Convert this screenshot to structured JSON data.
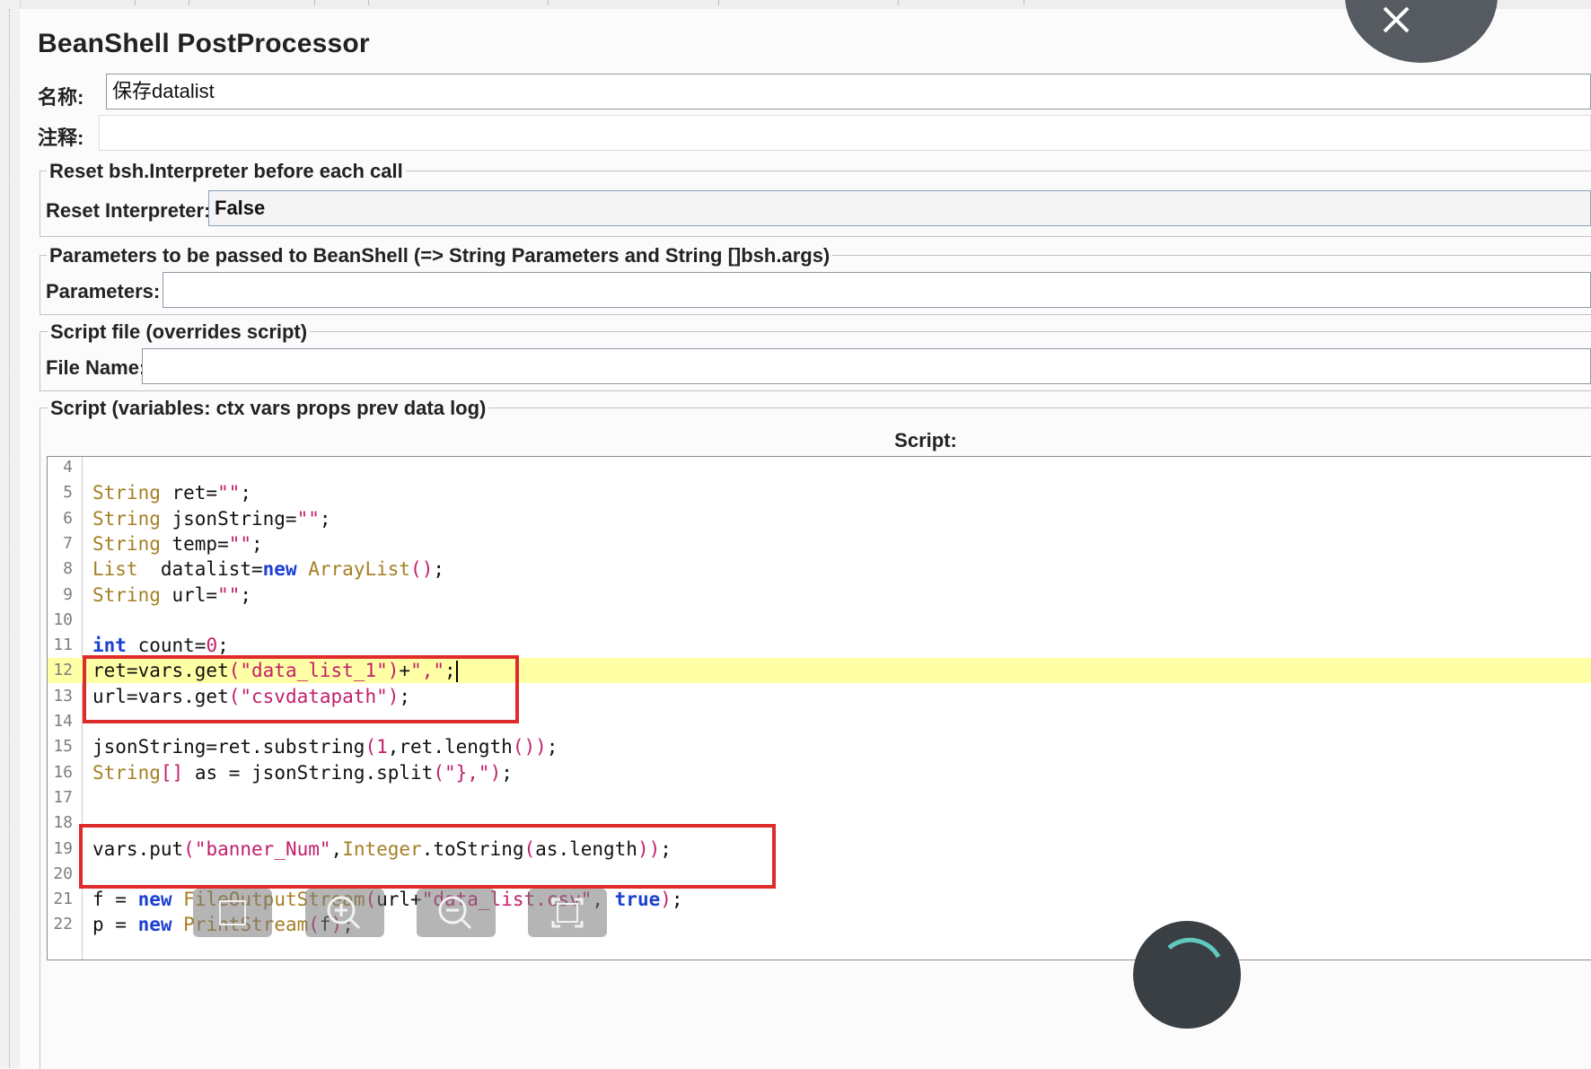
{
  "title": "BeanShell PostProcessor",
  "name_label": "名称:",
  "name_value": "保存datalist",
  "comment_label": "注释:",
  "comment_value": "",
  "reset_group": {
    "legend": "Reset bsh.Interpreter before each call",
    "label": "Reset Interpreter:",
    "value": "False"
  },
  "params_group": {
    "legend": "Parameters to be passed to BeanShell (=> String Parameters and String []bsh.args)",
    "label": "Parameters:",
    "value": ""
  },
  "file_group": {
    "legend": "Script file (overrides script)",
    "label": "File Name:",
    "value": ""
  },
  "script_group": {
    "legend": "Script (variables: ctx vars props prev data log)",
    "header": "Script:"
  },
  "code_lines": [
    {
      "n": "4",
      "text": ""
    },
    {
      "n": "5",
      "text": "String ret=\"\";"
    },
    {
      "n": "6",
      "text": "String jsonString=\"\";"
    },
    {
      "n": "7",
      "text": "String temp=\"\";"
    },
    {
      "n": "8",
      "text": "List  datalist=new ArrayList();"
    },
    {
      "n": "9",
      "text": "String url=\"\";"
    },
    {
      "n": "10",
      "text": ""
    },
    {
      "n": "11",
      "text": "int count=0;"
    },
    {
      "n": "12",
      "text": "ret=vars.get(\"data_list_1\")+\",\";"
    },
    {
      "n": "13",
      "text": "url=vars.get(\"csvdatapath\");"
    },
    {
      "n": "14",
      "text": ""
    },
    {
      "n": "15",
      "text": "jsonString=ret.substring(1,ret.length());"
    },
    {
      "n": "16",
      "text": "String[] as = jsonString.split(\"},\");"
    },
    {
      "n": "17",
      "text": ""
    },
    {
      "n": "18",
      "text": ""
    },
    {
      "n": "19",
      "text": "vars.put(\"banner_Num\",Integer.toString(as.length));"
    },
    {
      "n": "20",
      "text": ""
    },
    {
      "n": "21",
      "text": "f = new FileOutputStream(url+\"data_list.csv\", true);"
    },
    {
      "n": "22",
      "text": "p = new PrintStream(f);"
    }
  ],
  "highlight_line": "12",
  "colors": {
    "type": "#a57f24",
    "keyword": "#1b3fd1",
    "string": "#c21f6a",
    "highlight": "#ffffa6",
    "annotation_box": "#e02b2b"
  },
  "icons": [
    "close-icon",
    "zoom-in-icon",
    "zoom-out-icon",
    "fit-screen-icon"
  ]
}
